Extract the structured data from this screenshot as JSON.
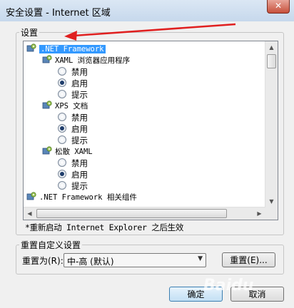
{
  "window": {
    "title": "安全设置 - Internet 区域",
    "close_glyph": "✕"
  },
  "settings_group": {
    "label": "设置"
  },
  "tree": {
    "items": [
      {
        "text": ".NET Framework",
        "kind": "category",
        "selected": true
      },
      {
        "text": "XAML 浏览器应用程序",
        "kind": "subcategory"
      },
      {
        "text": "禁用",
        "kind": "option",
        "checked": false
      },
      {
        "text": "启用",
        "kind": "option",
        "checked": true
      },
      {
        "text": "提示",
        "kind": "option",
        "checked": false
      },
      {
        "text": "XPS 文档",
        "kind": "subcategory"
      },
      {
        "text": "禁用",
        "kind": "option",
        "checked": false
      },
      {
        "text": "启用",
        "kind": "option",
        "checked": true
      },
      {
        "text": "提示",
        "kind": "option",
        "checked": false
      },
      {
        "text": "松散 XAML",
        "kind": "subcategory"
      },
      {
        "text": "禁用",
        "kind": "option",
        "checked": false
      },
      {
        "text": "启用",
        "kind": "option",
        "checked": true
      },
      {
        "text": "提示",
        "kind": "option",
        "checked": false
      },
      {
        "text": ".NET Framework 相关组件",
        "kind": "category"
      }
    ]
  },
  "restart_note": "*重新启动 Internet Explorer 之后生效",
  "reset_group": {
    "label": "重置自定义设置",
    "reset_to_label": "重置为(R):",
    "select_value": "中-高 (默认)",
    "reset_button": "重置(E)..."
  },
  "footer": {
    "ok_button": "确定",
    "cancel_button": "取消"
  },
  "watermark": "Baidu",
  "colors": {
    "selection": "#3399ff",
    "annotation_arrow": "#e02020"
  }
}
